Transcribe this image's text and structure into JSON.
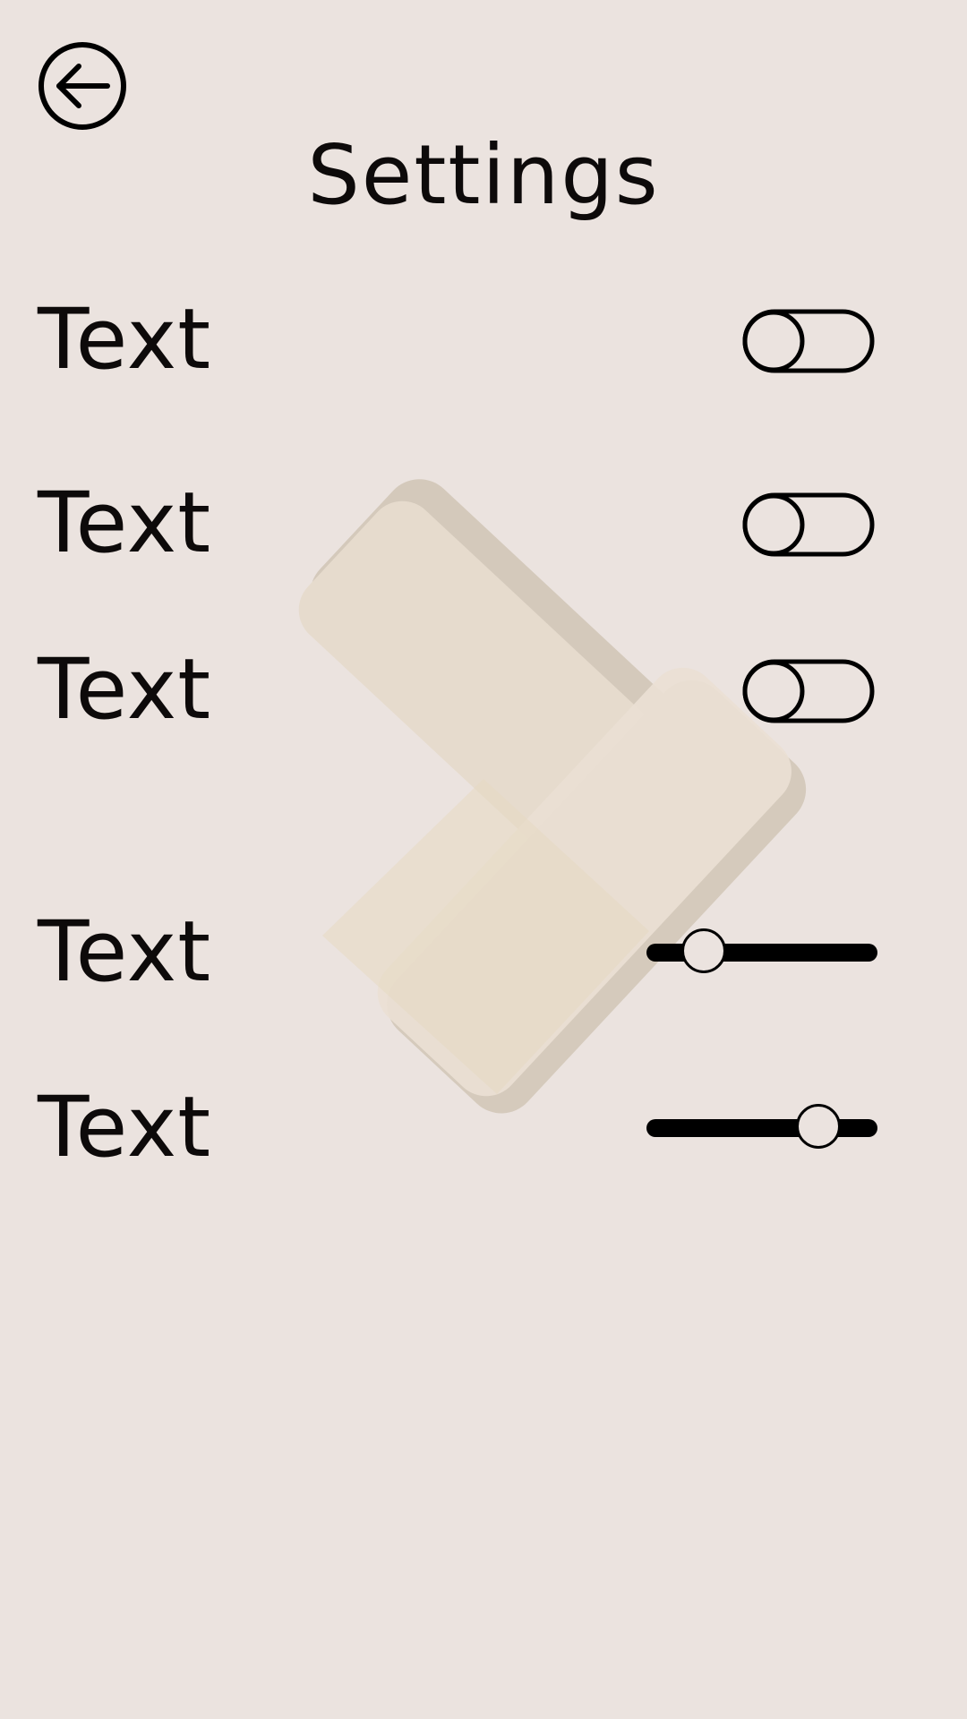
{
  "header": {
    "title": "Settings",
    "back_icon": "arrow-left-circle-icon"
  },
  "toggles": [
    {
      "label": "Text",
      "on": false
    },
    {
      "label": "Text",
      "on": false
    },
    {
      "label": "Text",
      "on": false
    }
  ],
  "sliders": [
    {
      "label": "Text",
      "value": 0.2
    },
    {
      "label": "Text",
      "value": 0.79
    }
  ],
  "colors": {
    "background": "#ebe3df",
    "foreground": "#000000",
    "logo": "#e8dac5"
  }
}
